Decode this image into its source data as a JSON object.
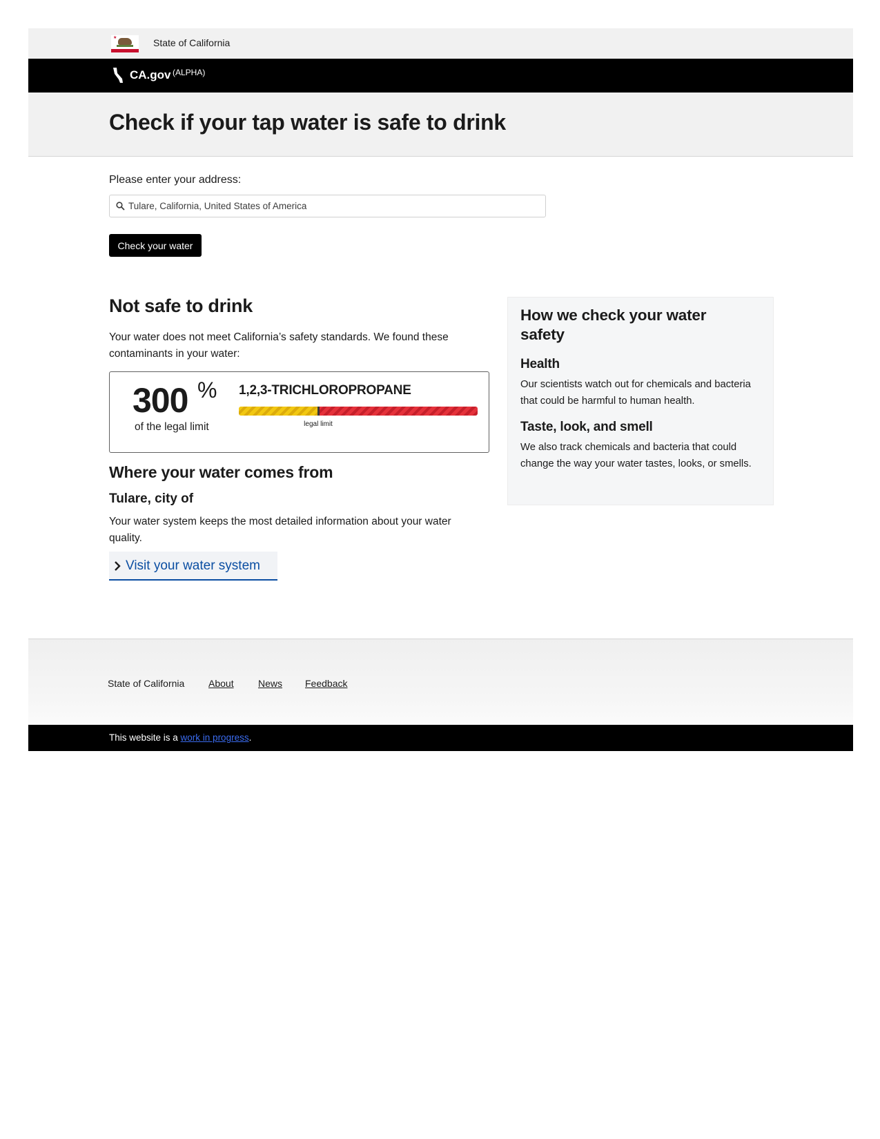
{
  "header": {
    "state_name": "State of California",
    "site_name": "CA.gov",
    "site_badge": "(ALPHA)",
    "page_title": "Check if your tap water is safe to drink"
  },
  "form": {
    "address_label": "Please enter your address:",
    "address_value": "Tulare, California, United States of America",
    "submit_label": "Check your water"
  },
  "result": {
    "heading": "Not safe to drink",
    "description": "Your water does not meet California’s safety standards. We found these contaminants in your water:",
    "contaminants": [
      {
        "percent_value": "300",
        "percent_symbol": "%",
        "percent_label": "of the legal limit",
        "name": "1,2,3-TRICHLOROPROPANE",
        "meter_limit_fraction": 0.333,
        "meter_limit_label": "legal limit"
      }
    ]
  },
  "source": {
    "heading": "Where your water comes from",
    "system_name": "Tulare, city of",
    "description": "Your water system keeps the most detailed information about your water quality.",
    "link_label": "Visit your water system"
  },
  "sidebar": {
    "heading": "How we check your water safety",
    "sections": [
      {
        "title": "Health",
        "text": "Our scientists watch out for chemicals and bacteria that could be harmful to human health."
      },
      {
        "title": "Taste, look, and smell",
        "text": "We also track chemicals and bacteria that could change the way your water tastes, looks, or smells."
      }
    ]
  },
  "footer": {
    "state_name": "State of California",
    "links": [
      "About",
      "News",
      "Feedback"
    ],
    "wip_prefix": "This website is a ",
    "wip_link": "work in progress",
    "wip_suffix": "."
  },
  "colors": {
    "link_blue": "#0b4ea2",
    "meter_yellow": "#f2c812",
    "meter_red": "#e5323b",
    "button_black": "#000000"
  },
  "icons": {
    "search": "search-icon",
    "chevron": "chevron-right-icon",
    "brand": "california-bear-icon",
    "flag": "california-flag-icon"
  }
}
